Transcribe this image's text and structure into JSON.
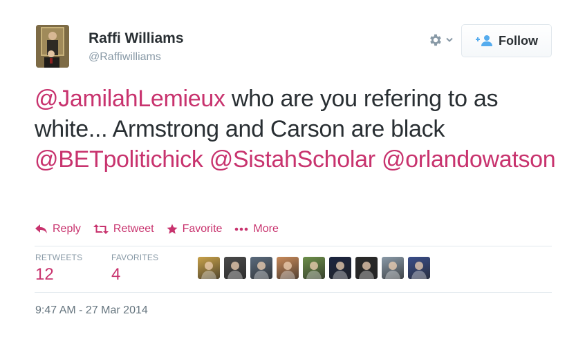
{
  "user": {
    "fullname": "Raffi Williams",
    "handle": "@Raffiwilliams"
  },
  "header": {
    "follow_label": "Follow",
    "gear_icon": "gear-icon",
    "follow_icon": "add-person-icon"
  },
  "tweet": {
    "segments": [
      {
        "text": "@JamilahLemieux",
        "mention": true
      },
      {
        "text": " who are you refering to as white... Armstrong and Carson are black ",
        "mention": false
      },
      {
        "text": "@BETpolitichick",
        "mention": true
      },
      {
        "text": " ",
        "mention": false
      },
      {
        "text": "@SistahScholar",
        "mention": true
      },
      {
        "text": " ",
        "mention": false
      },
      {
        "text": "@orlandowatson",
        "mention": true
      }
    ]
  },
  "actions": {
    "reply": "Reply",
    "retweet": "Retweet",
    "favorite": "Favorite",
    "more": "More"
  },
  "stats": {
    "retweets_label": "RETWEETS",
    "retweets_count": "12",
    "favorites_label": "FAVORITES",
    "favorites_count": "4"
  },
  "favoriters": [
    {
      "name": "favoriter-1",
      "bg": "#c9a24a"
    },
    {
      "name": "favoriter-2",
      "bg": "#4a4a4a"
    },
    {
      "name": "favoriter-3",
      "bg": "#5b6b7d"
    },
    {
      "name": "favoriter-4",
      "bg": "#c98a5a"
    },
    {
      "name": "favoriter-5",
      "bg": "#6d8f4a"
    },
    {
      "name": "favoriter-6",
      "bg": "#1c2540"
    },
    {
      "name": "favoriter-7",
      "bg": "#2a2a2a"
    },
    {
      "name": "favoriter-8",
      "bg": "#8a9aa8"
    },
    {
      "name": "favoriter-9",
      "bg": "#3a4e8a"
    }
  ],
  "timestamp": "9:47 AM - 27 Mar 2014",
  "colors": {
    "accent": "#c8336e",
    "text": "#292f33",
    "muted": "#8899a6",
    "border": "#e1e8ed"
  }
}
